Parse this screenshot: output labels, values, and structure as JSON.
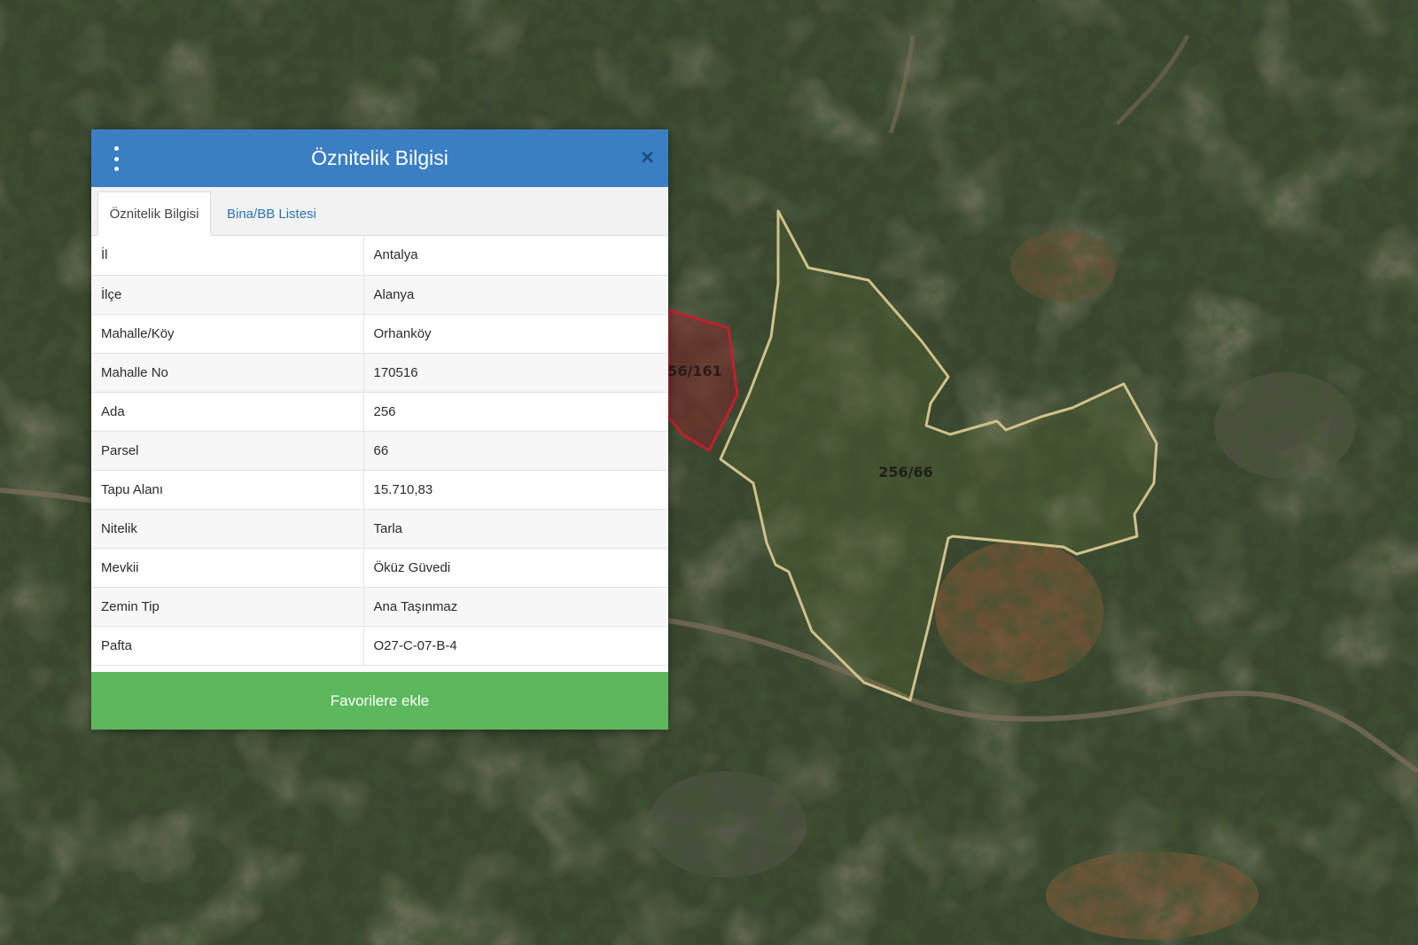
{
  "map": {
    "parcels": [
      {
        "label": "56/161",
        "color": "#b3242f"
      },
      {
        "label": "256/66",
        "color": "#d4c98a"
      }
    ]
  },
  "panel": {
    "title": "Öznitelik Bilgisi",
    "icons": {
      "menu": "vertical-dots-icon",
      "close": "close-icon"
    },
    "tabs": [
      {
        "label": "Öznitelik Bilgisi",
        "active": true
      },
      {
        "label": "Bina/BB Listesi",
        "active": false
      }
    ],
    "rows": [
      {
        "key": "İl",
        "value": "Antalya"
      },
      {
        "key": "İlçe",
        "value": "Alanya"
      },
      {
        "key": "Mahalle/Köy",
        "value": "Orhanköy"
      },
      {
        "key": "Mahalle No",
        "value": "170516"
      },
      {
        "key": "Ada",
        "value": "256"
      },
      {
        "key": "Parsel",
        "value": "66"
      },
      {
        "key": "Tapu Alanı",
        "value": "15.710,83"
      },
      {
        "key": "Nitelik",
        "value": "Tarla"
      },
      {
        "key": "Mevkii",
        "value": "Öküz Güvedi"
      },
      {
        "key": "Zemin Tip",
        "value": "Ana Taşınmaz"
      },
      {
        "key": "Pafta",
        "value": "O27-C-07-B-4"
      }
    ],
    "favorite_label": "Favorilere ekle",
    "colors": {
      "header": "#3a7fc4",
      "button": "#5cb85c",
      "link": "#2d72b5"
    }
  }
}
